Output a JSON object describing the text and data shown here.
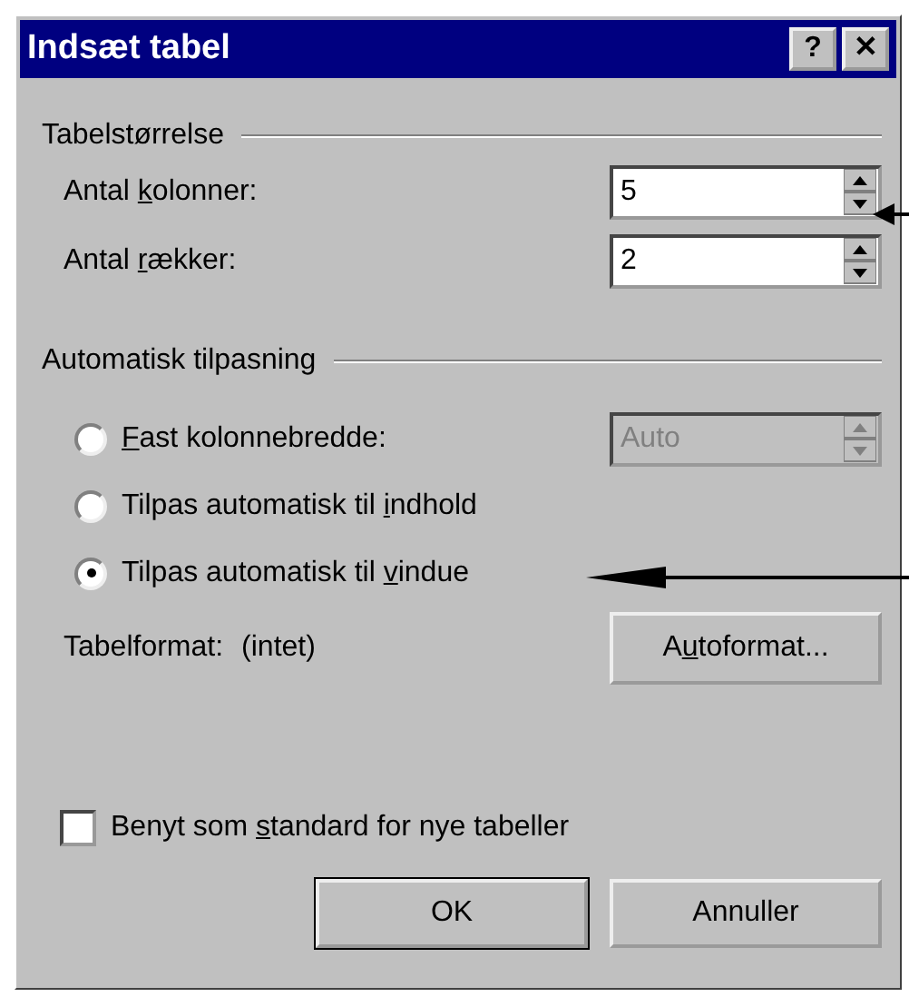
{
  "window": {
    "title": "Indsæt tabel",
    "help_button": "?",
    "close_button": "✕"
  },
  "size_group": {
    "title": "Tabelstørrelse",
    "fields": [
      {
        "label": [
          "Antal ",
          "k",
          "olonner:"
        ],
        "value": "5",
        "disabled": false
      },
      {
        "label": [
          "Antal ",
          "r",
          "ækker:"
        ],
        "value": "2",
        "disabled": false
      }
    ]
  },
  "autofit_group": {
    "title": "Automatisk tilpasning",
    "options": [
      {
        "label": {
          "key": "F",
          "post": "ast kolonnebredde:"
        },
        "selected": false,
        "field": {
          "value": "Auto",
          "disabled": true
        }
      },
      {
        "label": {
          "pre": "Tilpas automatisk til ",
          "key": "i",
          "post": "ndhold"
        },
        "selected": false
      },
      {
        "label": {
          "pre": "Tilpas automatisk til ",
          "key": "v",
          "post": "indue"
        },
        "selected": true
      }
    ]
  },
  "table_format": {
    "label": "Tabelformat:",
    "value": "(intet)",
    "button": [
      "A",
      "u",
      "toformat..."
    ]
  },
  "default_checkbox": {
    "label": [
      "Benyt som ",
      "s",
      "tandard for nye tabeller"
    ],
    "checked": false
  },
  "buttons": [
    {
      "label": "OK",
      "default": true
    },
    {
      "label": "Annuller",
      "default": false
    }
  ]
}
